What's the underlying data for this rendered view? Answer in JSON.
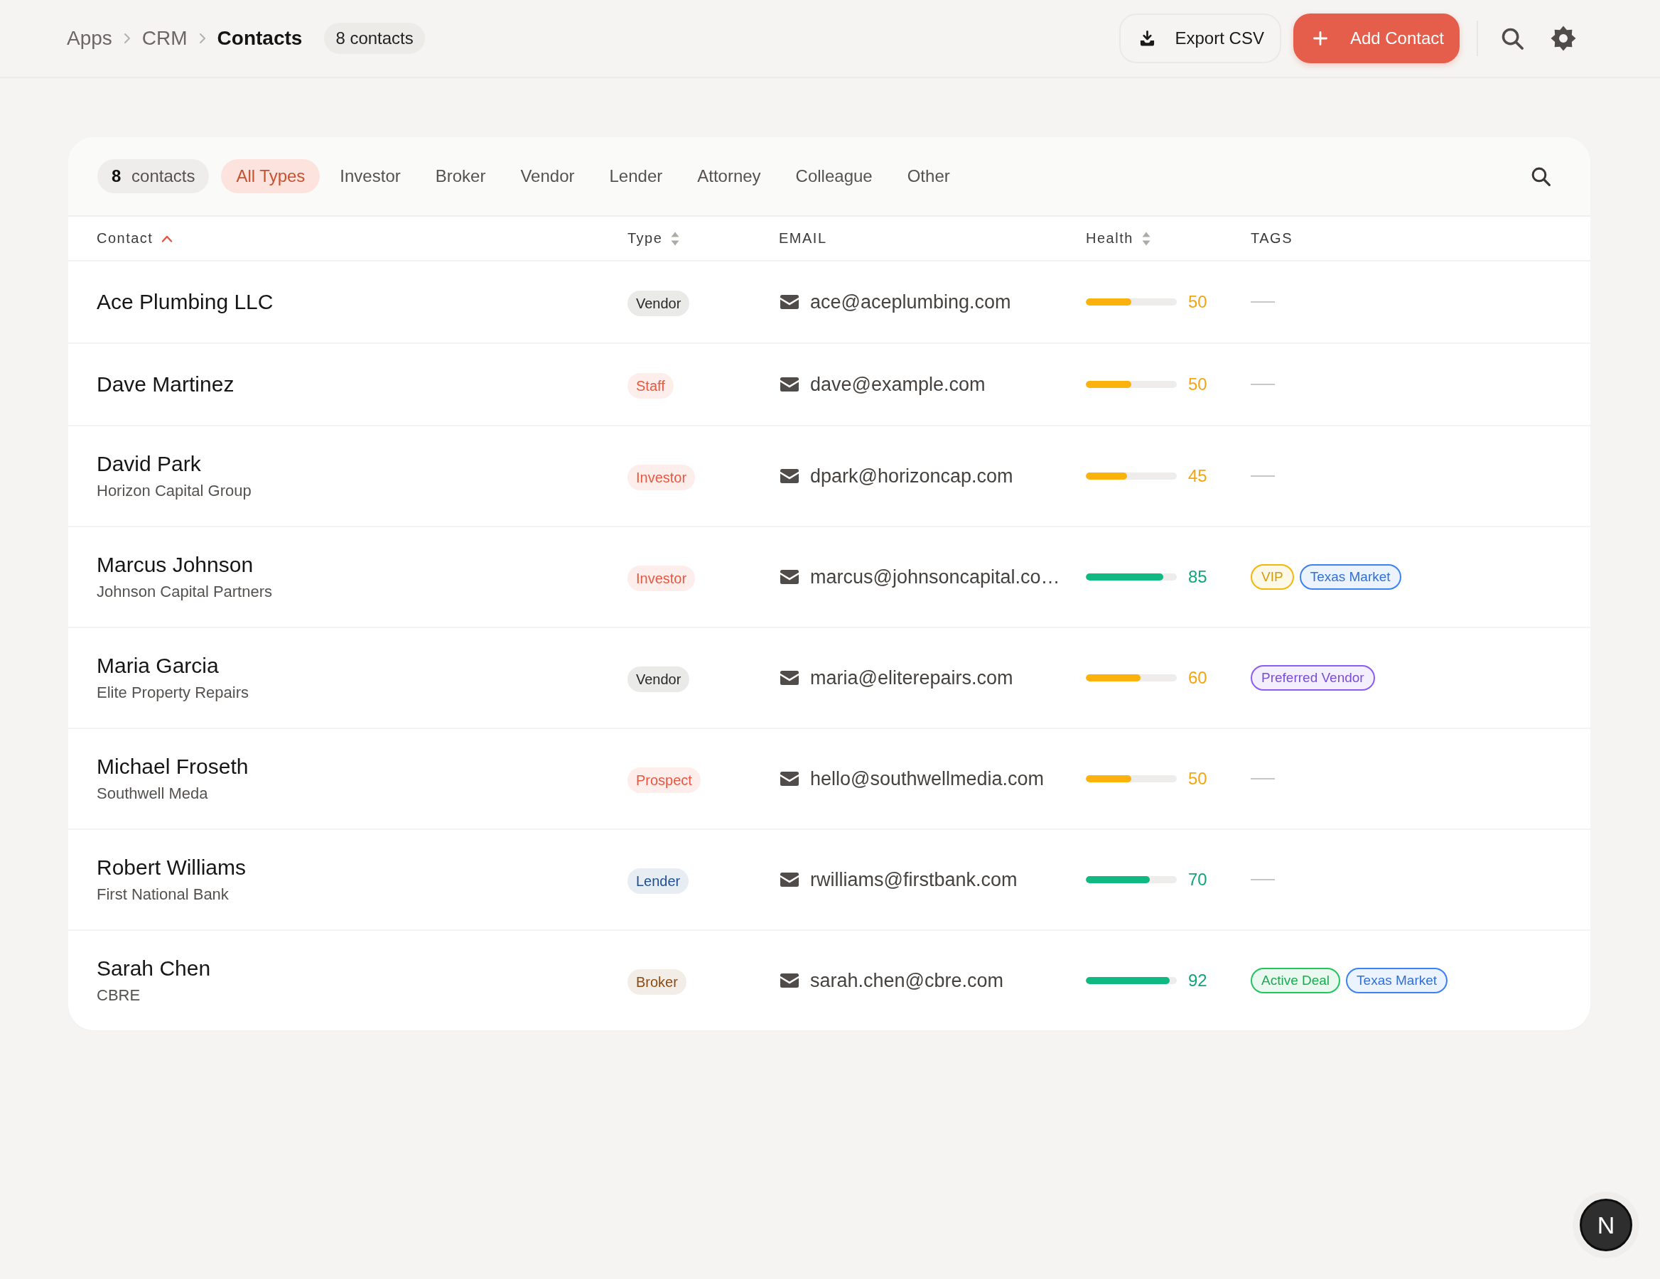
{
  "header": {
    "breadcrumb": [
      {
        "label": "Apps",
        "current": false
      },
      {
        "label": "CRM",
        "current": false
      },
      {
        "label": "Contacts",
        "current": true
      }
    ],
    "count_badge": "8 contacts",
    "actions": [
      {
        "kind": "export",
        "label": "Export CSV"
      },
      {
        "kind": "add",
        "label": "Add Contact"
      }
    ]
  },
  "filters": {
    "count": "**8** contacts",
    "tabs": [
      {
        "label": "All Types",
        "selected": true
      },
      {
        "label": "Investor",
        "selected": false
      },
      {
        "label": "Broker",
        "selected": false
      },
      {
        "label": "Vendor",
        "selected": false
      },
      {
        "label": "Lender",
        "selected": false
      },
      {
        "label": "Attorney",
        "selected": false
      },
      {
        "label": "Colleague",
        "selected": false
      },
      {
        "label": "Other",
        "selected": false
      }
    ]
  },
  "table": {
    "columns": [
      {
        "label": "Contact",
        "sortable": true,
        "sorted": true
      },
      {
        "label": "Type",
        "sortable": true,
        "sorted": false
      },
      {
        "label": "EMAIL"
      },
      {
        "label": "Health",
        "sortable": true,
        "sorted": false
      },
      {
        "label": "TAGS"
      }
    ],
    "rows": [
      {
        "name": "Ace Plumbing LLC",
        "type": {
          "label": "Vendor",
          "color": "#2a2826"
        },
        "email": "ace@aceplumbing.com",
        "health": {
          "level": 0.5,
          "reading": "50"
        },
        "tags": []
      },
      {
        "name": "Dave Martinez",
        "type": {
          "label": "Staff",
          "color": "#e8573f"
        },
        "email": "dave@example.com",
        "health": {
          "level": 0.5,
          "reading": "50"
        },
        "tags": []
      },
      {
        "name": "David Park",
        "company": "Horizon Capital Group",
        "type": {
          "label": "Investor",
          "color": "#e8573f"
        },
        "email": "dpark@horizoncap.com",
        "health": {
          "level": 0.45,
          "reading": "45"
        },
        "tags": []
      },
      {
        "name": "Marcus Johnson",
        "company": "Johnson Capital Partners",
        "type": {
          "label": "Investor",
          "color": "#e8573f"
        },
        "email": "marcus@johnsoncapital.co…",
        "health": {
          "level": 0.85,
          "reading": "85"
        },
        "tags": [
          {
            "label": "VIP",
            "color": "#f5b60a"
          },
          {
            "label": "Texas Market",
            "color": "#3b82f6"
          }
        ]
      },
      {
        "name": "Maria Garcia",
        "company": "Elite Property Repairs",
        "type": {
          "label": "Vendor",
          "color": "#2a2826"
        },
        "email": "maria@eliterepairs.com",
        "health": {
          "level": 0.6,
          "reading": "60"
        },
        "tags": [
          {
            "label": "Preferred Vendor",
            "color": "#8b5cf6"
          }
        ]
      },
      {
        "name": "Michael Froseth",
        "company": "Southwell Meda",
        "type": {
          "label": "Prospect",
          "color": "#e8573f"
        },
        "email": "hello@southwellmedia.com",
        "health": {
          "level": 0.5,
          "reading": "50"
        },
        "tags": []
      },
      {
        "name": "Robert Williams",
        "company": "First National Bank",
        "type": {
          "label": "Lender",
          "color": "#1d4f91"
        },
        "email": "rwilliams@firstbank.com",
        "health": {
          "level": 0.7,
          "reading": "70"
        },
        "tags": []
      },
      {
        "name": "Sarah Chen",
        "company": "CBRE",
        "type": {
          "label": "Broker",
          "color": "#8a4b14"
        },
        "email": "sarah.chen@cbre.com",
        "health": {
          "level": 0.92,
          "reading": "92"
        },
        "tags": [
          {
            "label": "Active Deal",
            "color": "#22c55e"
          },
          {
            "label": "Texas Market",
            "color": "#3b82f6"
          }
        ]
      }
    ]
  },
  "dev_badge": {
    "label": "N"
  }
}
